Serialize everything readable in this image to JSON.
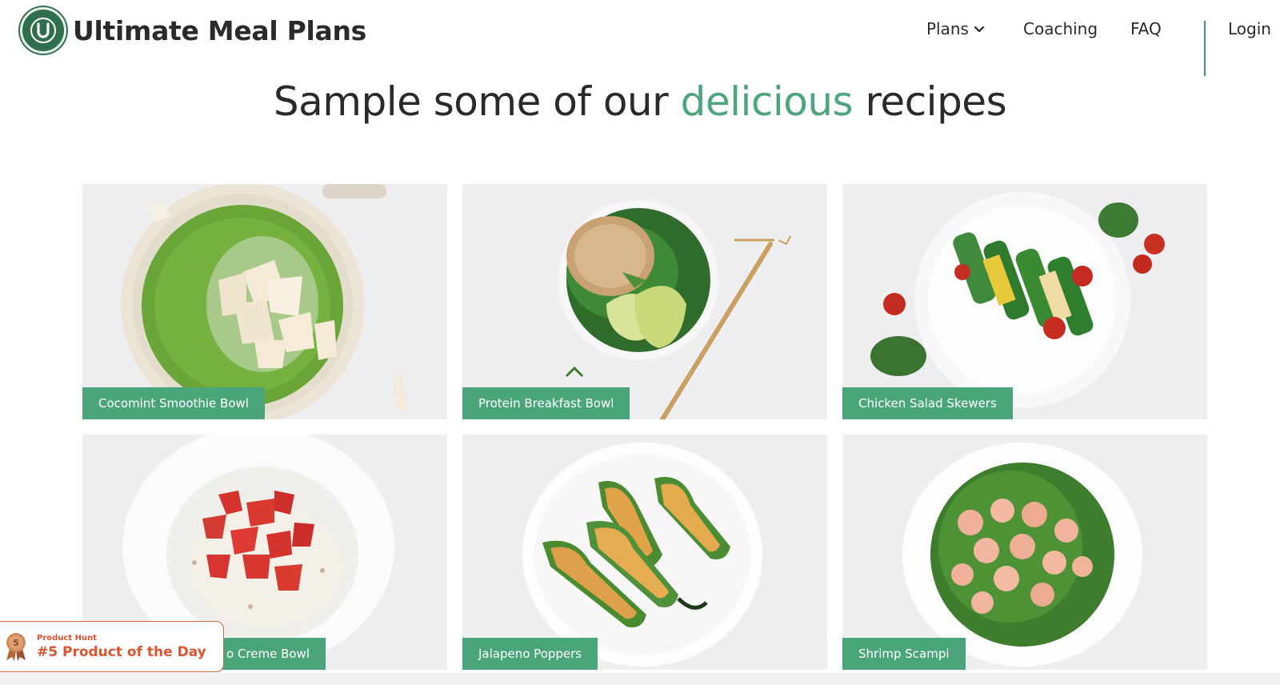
{
  "header": {
    "brand": "Ultimate Meal Plans",
    "logo_letter": "U",
    "nav": {
      "plans": "Plans",
      "coaching": "Coaching",
      "faq": "FAQ",
      "login": "Login"
    }
  },
  "headline": {
    "before": "Sample some of our ",
    "accent": "delicious",
    "after": " recipes"
  },
  "recipes": [
    {
      "label": "Cocomint Smoothie Bowl"
    },
    {
      "label": "Protein Breakfast Bowl"
    },
    {
      "label": "Chicken Salad Skewers"
    },
    {
      "label": "Berries & Creme Bowl",
      "visible_label": "o Creme Bowl"
    },
    {
      "label": "Jalapeno Poppers"
    },
    {
      "label": "Shrimp Scampi"
    }
  ],
  "product_hunt": {
    "small": "Product Hunt",
    "big": "#5 Product of the Day",
    "rank": "5"
  },
  "colors": {
    "accent": "#4ca57c",
    "brand_dark": "#2f6f4f",
    "label_bg": "#4ba57b",
    "product_hunt": "#da552f"
  }
}
